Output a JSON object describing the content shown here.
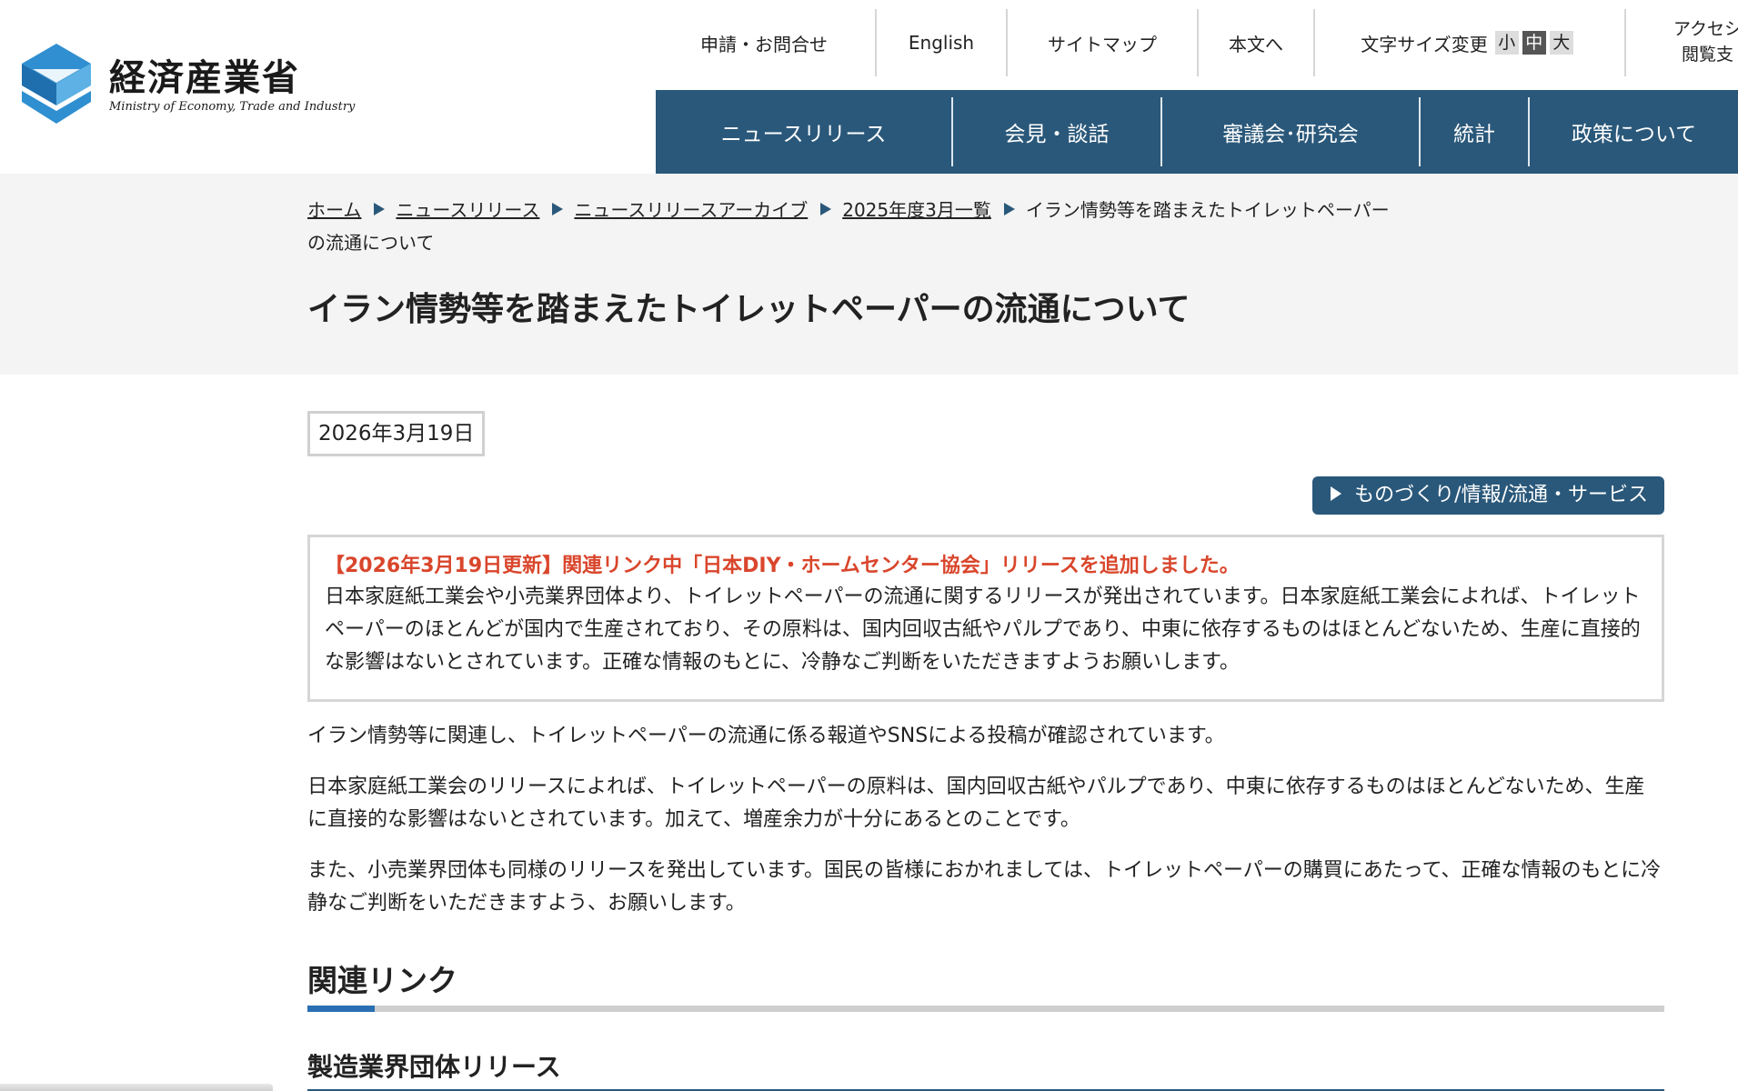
{
  "header": {
    "logo": {
      "ja": "経済産業省",
      "en": "Ministry of Economy, Trade and Industry"
    },
    "utility": {
      "contact": "申請・お問合せ",
      "english": "English",
      "sitemap": "サイトマップ",
      "skip_to_content": "本文へ",
      "font_size_label": "文字サイズ変更",
      "font_sizes": [
        "小",
        "中",
        "大"
      ],
      "accessibility_line1": "アクセシ",
      "accessibility_line2": "閲覧支"
    },
    "nav": [
      "ニュースリリース",
      "会見・談話",
      "審議会･研究会",
      "統計",
      "政策について"
    ]
  },
  "breadcrumb": {
    "items": [
      "ホーム",
      "ニュースリリース",
      "ニュースリリースアーカイブ",
      "2025年度3月一覧"
    ],
    "current": "イラン情勢等を踏まえたトイレットペーパーの流通について"
  },
  "page": {
    "title": "イラン情勢等を踏まえたトイレットペーパーの流通について",
    "date": "2026年3月19日",
    "category": "ものづくり/情報/流通・サービス",
    "notice": {
      "update": "【2026年3月19日更新】関連リンク中「日本DIY・ホームセンター協会」リリースを追加しました。",
      "body": "日本家庭紙工業会や小売業界団体より、トイレットペーパーの流通に関するリリースが発出されています。日本家庭紙工業会によれば、トイレットペーパーのほとんどが国内で生産されており、その原料は、国内回収古紙やパルプであり、中東に依存するものはほとんどないため、生産に直接的な影響はないとされています。正確な情報のもとに、冷静なご判断をいただきますようお願いします。"
    },
    "paragraphs": [
      "イラン情勢等に関連し、トイレットペーパーの流通に係る報道やSNSによる投稿が確認されています。",
      "日本家庭紙工業会のリリースによれば、トイレットペーパーの原料は、国内回収古紙やパルプであり、中東に依存するものはほとんどないため、生産に直接的な影響はないとされています。加えて、増産余力が十分にあるとのことです。",
      "また、小売業界団体も同様のリリースを発出しています。国民の皆様におかれましては、トイレットペーパーの購買にあたって、正確な情報のもとに冷静なご判断をいただきますよう、お願いします。"
    ],
    "related_heading": "関連リンク",
    "subheading": "製造業界団体リリース"
  },
  "colors": {
    "nav_bg": "#2a587a",
    "update_red": "#d9462c",
    "accent_blue": "#2a6fb3",
    "band_bg": "#f3f4f3"
  }
}
